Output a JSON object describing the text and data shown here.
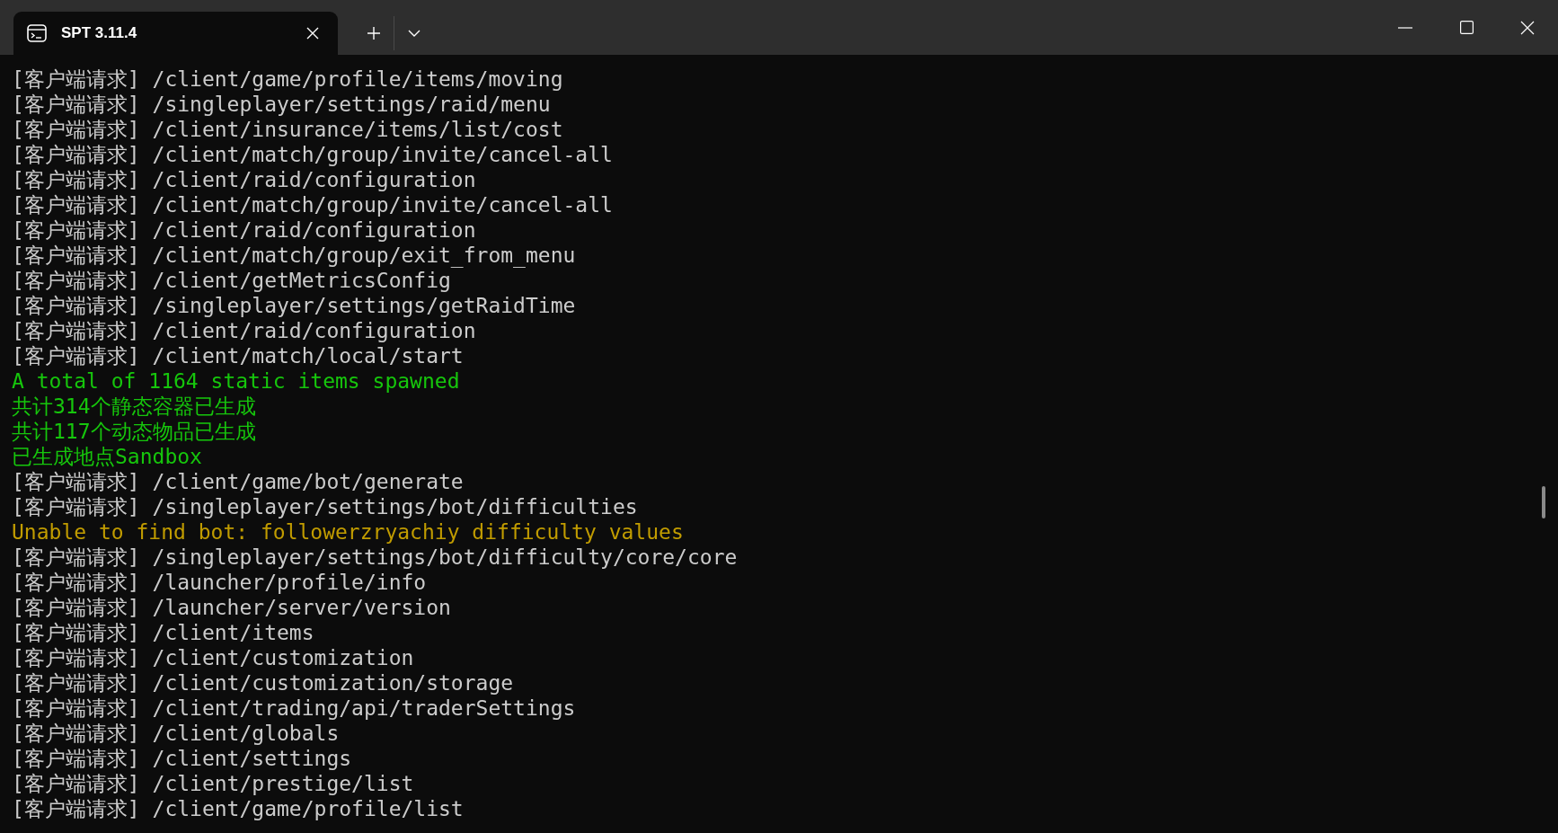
{
  "tab": {
    "title": "SPT 3.11.4",
    "selected": true
  },
  "lines": [
    {
      "kind": "normal",
      "text": "[客户端请求] /client/game/profile/items/moving"
    },
    {
      "kind": "normal",
      "text": "[客户端请求] /singleplayer/settings/raid/menu"
    },
    {
      "kind": "normal",
      "text": "[客户端请求] /client/insurance/items/list/cost"
    },
    {
      "kind": "normal",
      "text": "[客户端请求] /client/match/group/invite/cancel-all"
    },
    {
      "kind": "normal",
      "text": "[客户端请求] /client/raid/configuration"
    },
    {
      "kind": "normal",
      "text": "[客户端请求] /client/match/group/invite/cancel-all"
    },
    {
      "kind": "normal",
      "text": "[客户端请求] /client/raid/configuration"
    },
    {
      "kind": "normal",
      "text": "[客户端请求] /client/match/group/exit_from_menu"
    },
    {
      "kind": "normal",
      "text": "[客户端请求] /client/getMetricsConfig"
    },
    {
      "kind": "normal",
      "text": "[客户端请求] /singleplayer/settings/getRaidTime"
    },
    {
      "kind": "normal",
      "text": "[客户端请求] /client/raid/configuration"
    },
    {
      "kind": "normal",
      "text": "[客户端请求] /client/match/local/start"
    },
    {
      "kind": "success",
      "text": "A total of 1164 static items spawned"
    },
    {
      "kind": "success",
      "text": "共计314个静态容器已生成"
    },
    {
      "kind": "success",
      "text": "共计117个动态物品已生成"
    },
    {
      "kind": "success",
      "text": "已生成地点Sandbox"
    },
    {
      "kind": "normal",
      "text": "[客户端请求] /client/game/bot/generate"
    },
    {
      "kind": "normal",
      "text": "[客户端请求] /singleplayer/settings/bot/difficulties"
    },
    {
      "kind": "warning",
      "text": "Unable to find bot: followerzryachiy difficulty values"
    },
    {
      "kind": "normal",
      "text": "[客户端请求] /singleplayer/settings/bot/difficulty/core/core"
    },
    {
      "kind": "normal",
      "text": "[客户端请求] /launcher/profile/info"
    },
    {
      "kind": "normal",
      "text": "[客户端请求] /launcher/server/version"
    },
    {
      "kind": "normal",
      "text": "[客户端请求] /client/items"
    },
    {
      "kind": "normal",
      "text": "[客户端请求] /client/customization"
    },
    {
      "kind": "normal",
      "text": "[客户端请求] /client/customization/storage"
    },
    {
      "kind": "normal",
      "text": "[客户端请求] /client/trading/api/traderSettings"
    },
    {
      "kind": "normal",
      "text": "[客户端请求] /client/globals"
    },
    {
      "kind": "normal",
      "text": "[客户端请求] /client/settings"
    },
    {
      "kind": "normal",
      "text": "[客户端请求] /client/prestige/list"
    },
    {
      "kind": "normal",
      "text": "[客户端请求] /client/game/profile/list"
    }
  ]
}
